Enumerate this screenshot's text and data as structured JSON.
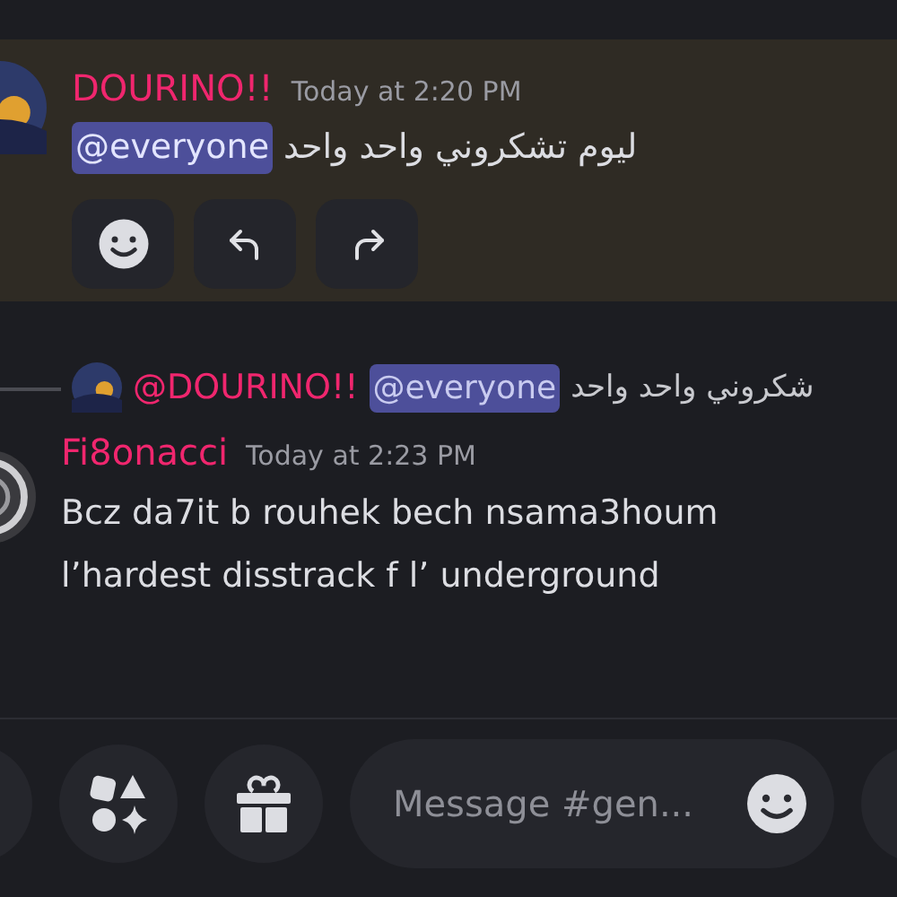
{
  "messages": [
    {
      "author": "DOURINO!!",
      "time": "Today at 2:20 PM",
      "highlighted": true,
      "mention": "@everyone",
      "text": "ليوم تشكروني واحد واحد",
      "actions": [
        {
          "kind": "emoji"
        },
        {
          "kind": "reply"
        },
        {
          "kind": "forward"
        }
      ]
    },
    {
      "author": "Fi8onacci",
      "time": "Today at 2:23 PM",
      "highlighted": false,
      "reply": {
        "author": "@DOURINO!!",
        "mention": "@everyone",
        "text": "شكروني واحد واحد"
      },
      "lines": [
        "Bcz da7it b rouhek bech nsama3houm",
        "l’hardest disstrack f l’ underground"
      ]
    }
  ],
  "composer": {
    "placeholder": "Message #gen..."
  }
}
